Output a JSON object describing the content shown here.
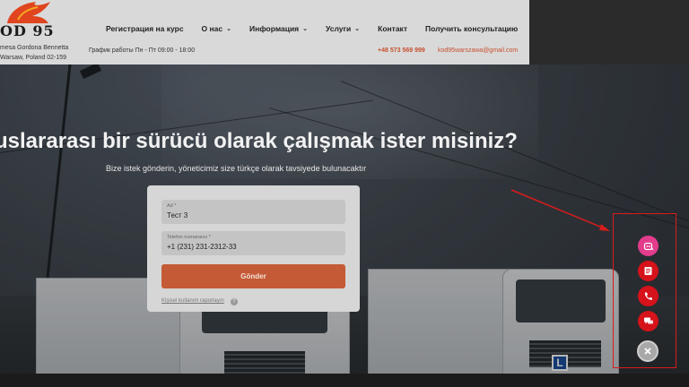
{
  "header": {
    "logo_text": "OD 95",
    "address_line1": "mesa Gordona Bennetta",
    "address_line2": "Warsaw, Poland 02-159",
    "nav": [
      {
        "label": "Регистрация на курс",
        "has_dropdown": false
      },
      {
        "label": "О нас",
        "has_dropdown": true
      },
      {
        "label": "Информация",
        "has_dropdown": true
      },
      {
        "label": "Услуги",
        "has_dropdown": true
      },
      {
        "label": "Контакт",
        "has_dropdown": false
      },
      {
        "label": "Получить консультацию",
        "has_dropdown": false
      }
    ],
    "schedule": "График работы Пн - Пт 09:00 - 18:00",
    "phone": "+48 573 569 999",
    "email": "kod95warszawa@gmail.com"
  },
  "hero": {
    "title": "uslararası bir sürücü olarak çalışmak ister misiniz?",
    "subtitle": "Bize istek gönderin, yöneticimiz size türkçe olarak tavsiyede bulunacaktır"
  },
  "form": {
    "name_label": "Ad *",
    "name_value": "Тест 3",
    "phone_label": "Telefon numaranız *",
    "phone_value": "+1 (231) 231-2312-33",
    "submit_label": "Gönder",
    "privacy_link": "Kişisel kullanım raporlayın"
  },
  "truck_plate": "L",
  "colors": {
    "accent": "#c45a36",
    "widget_red": "#d6121b",
    "widget_pink": "#e23c8c",
    "annotation": "#d81c1c"
  },
  "icons": {
    "widget_bot": "bot-icon",
    "widget_form": "form-icon",
    "widget_phone": "phone-icon",
    "widget_chat": "chat-icon",
    "widget_close": "close-icon"
  }
}
